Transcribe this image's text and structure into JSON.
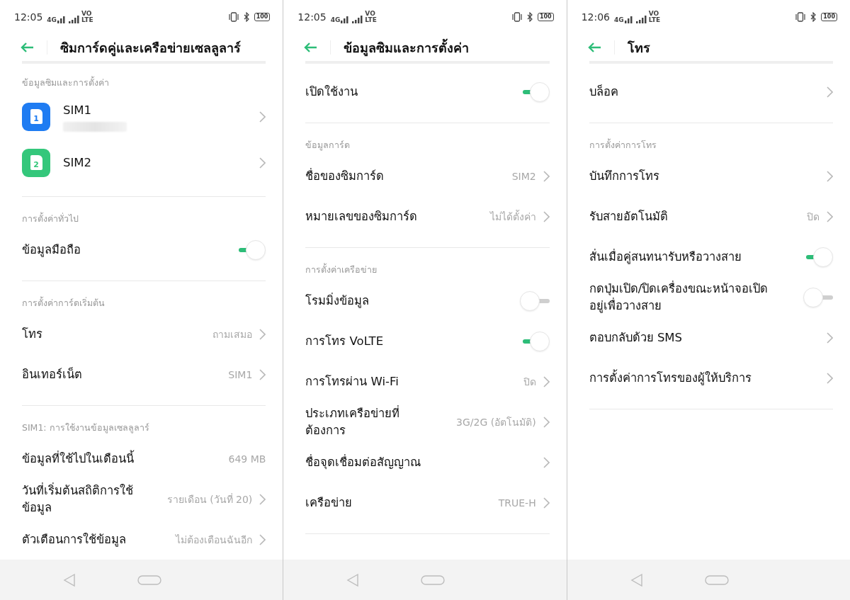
{
  "screens": [
    {
      "status_bar": {
        "time": "12:05",
        "network": "4G",
        "volte": [
          "VO",
          "LTE"
        ],
        "battery": "100"
      },
      "title": "ซิมการ์ดคู่และเครือข่ายเซลลูลาร์",
      "items": [
        {
          "kind": "section",
          "label": "ข้อมูลซิมและการตั้งค่า"
        },
        {
          "kind": "sim",
          "label": "SIM1",
          "number": "1",
          "color": "#1f7cf2",
          "redacted": true
        },
        {
          "kind": "sim",
          "label": "SIM2",
          "number": "2",
          "color": "#34c77b",
          "redacted": false
        },
        {
          "kind": "divider"
        },
        {
          "kind": "section",
          "label": "การตั้งค่าทั่วไป"
        },
        {
          "kind": "toggle",
          "label": "ข้อมูลมือถือ",
          "on": true
        },
        {
          "kind": "divider"
        },
        {
          "kind": "section",
          "label": "การตั้งค่าการ์ดเริ่มต้น"
        },
        {
          "kind": "nav",
          "label": "โทร",
          "value": "ถามเสมอ"
        },
        {
          "kind": "nav",
          "label": "อินเทอร์เน็ต",
          "value": "SIM1"
        },
        {
          "kind": "divider"
        },
        {
          "kind": "section",
          "label": "SIM1: การใช้งานข้อมูลเซลลูลาร์"
        },
        {
          "kind": "info",
          "label": "ข้อมูลที่ใช้ไปในเดือนนี้",
          "value": "649 MB"
        },
        {
          "kind": "nav",
          "label": "วันที่เริ่มต้นสถิติการใช้ข้อมูล",
          "value": "รายเดือน (วันที่ 20)"
        },
        {
          "kind": "nav",
          "label": "ตัวเตือนการใช้ข้อมูล",
          "value": "ไม่ต้องเตือนฉันอีก"
        }
      ]
    },
    {
      "status_bar": {
        "time": "12:05",
        "network": "4G",
        "volte": [
          "VO",
          "LTE"
        ],
        "battery": "100"
      },
      "title": "ข้อมูลซิมและการตั้งค่า",
      "items": [
        {
          "kind": "toggle",
          "label": "เปิดใช้งาน",
          "on": true
        },
        {
          "kind": "divider"
        },
        {
          "kind": "section",
          "label": "ข้อมูลการ์ด"
        },
        {
          "kind": "nav",
          "label": "ชื่อของซิมการ์ด",
          "value": "SIM2"
        },
        {
          "kind": "nav",
          "label": "หมายเลขของซิมการ์ด",
          "value": "ไม่ได้ตั้งค่า"
        },
        {
          "kind": "divider"
        },
        {
          "kind": "section",
          "label": "การตั้งค่าเครือข่าย"
        },
        {
          "kind": "toggle",
          "label": "โรมมิ่งข้อมูล",
          "on": false
        },
        {
          "kind": "toggle",
          "label": "การโทร VoLTE",
          "on": true
        },
        {
          "kind": "nav",
          "label": "การโทรผ่าน Wi-Fi",
          "value": "ปิด"
        },
        {
          "kind": "nav",
          "label": "ประเภทเครือข่ายที่ต้องการ",
          "value": "3G/2G (อัตโนมัติ)"
        },
        {
          "kind": "nav",
          "label": "ชื่อจุดเชื่อมต่อสัญญาณ"
        },
        {
          "kind": "nav",
          "label": "เครือข่าย",
          "value": "TRUE-H"
        },
        {
          "kind": "divider"
        }
      ]
    },
    {
      "status_bar": {
        "time": "12:06",
        "network": "4G",
        "volte": [
          "VO",
          "LTE"
        ],
        "battery": "100"
      },
      "title": "โทร",
      "items": [
        {
          "kind": "nav",
          "label": "บล็อค"
        },
        {
          "kind": "divider"
        },
        {
          "kind": "section",
          "label": "การตั้งค่าการโทร"
        },
        {
          "kind": "nav",
          "label": "บันทึกการโทร"
        },
        {
          "kind": "nav",
          "label": "รับสายอัตโนมัติ",
          "value": "ปิด"
        },
        {
          "kind": "toggle",
          "label": "สั่นเมื่อคู่สนทนารับหรือวางสาย",
          "on": true
        },
        {
          "kind": "toggle",
          "label": "กดปุ่มเปิด/ปิดเครื่องขณะหน้าจอเปิดอยู่เพื่อวางสาย",
          "on": false
        },
        {
          "kind": "nav",
          "label": "ตอบกลับด้วย SMS"
        },
        {
          "kind": "nav",
          "label": "การตั้งค่าการโทรของผู้ให้บริการ"
        },
        {
          "kind": "divider"
        }
      ]
    }
  ]
}
